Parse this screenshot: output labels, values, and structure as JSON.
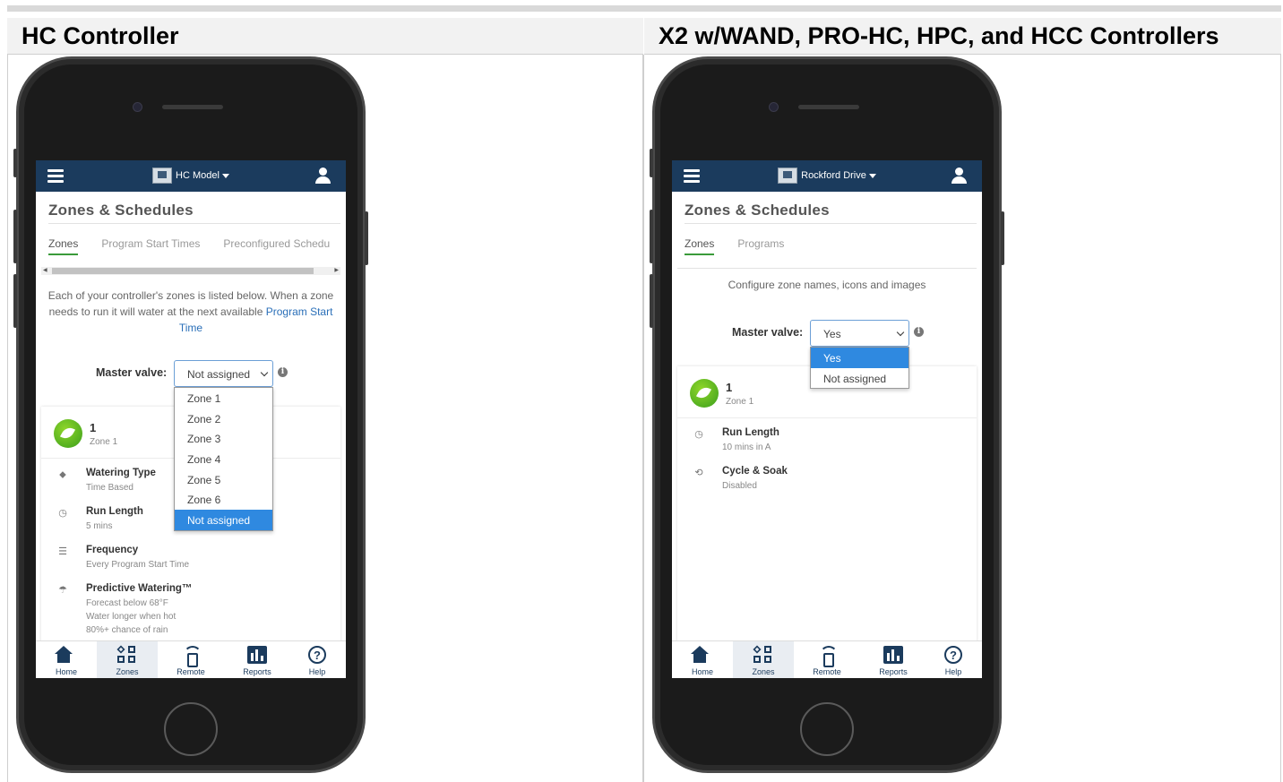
{
  "headers": {
    "left": "HC Controller",
    "right": "X2 w/WAND, PRO-HC, HPC, and HCC Controllers"
  },
  "left_phone": {
    "controller_name": "HC Model",
    "page_title": "Zones & Schedules",
    "tabs": [
      "Zones",
      "Program Start Times",
      "Preconfigured Schedu"
    ],
    "info_text": "Each of your controller's zones is listed below. When a zone needs to run it will water at the next available ",
    "info_link": "Program Start Time",
    "master_valve_label": "Master valve:",
    "master_valve_value": "Not assigned",
    "dropdown_options": [
      "Zone 1",
      "Zone 2",
      "Zone 3",
      "Zone 4",
      "Zone 5",
      "Zone 6",
      "Not assigned"
    ],
    "dropdown_selected_index": 6,
    "zone_number": "1",
    "zone_name": "Zone 1",
    "details": [
      {
        "icon": "tag-icon",
        "title": "Watering Type",
        "lines": [
          "Time Based"
        ]
      },
      {
        "icon": "clock-icon",
        "title": "Run Length",
        "lines": [
          "5 mins"
        ]
      },
      {
        "icon": "list-icon",
        "title": "Frequency",
        "lines": [
          "Every Program Start Time"
        ]
      },
      {
        "icon": "umbrella-icon",
        "title": "Predictive Watering™",
        "lines": [
          "Forecast below 68°F",
          "Water longer when hot",
          "80%+ chance of rain"
        ]
      }
    ]
  },
  "right_phone": {
    "controller_name": "Rockford Drive",
    "page_title": "Zones & Schedules",
    "tabs": [
      "Zones",
      "Programs"
    ],
    "info_text": "Configure zone names, icons and images",
    "master_valve_label": "Master valve:",
    "master_valve_value": "Yes",
    "dropdown_options": [
      "Yes",
      "Not assigned"
    ],
    "dropdown_selected_index": 0,
    "zone_number": "1",
    "zone_name": "Zone 1",
    "details": [
      {
        "icon": "clock-icon",
        "title": "Run Length",
        "lines": [
          "10 mins in A"
        ]
      },
      {
        "icon": "cycle-icon",
        "title": "Cycle & Soak",
        "lines": [
          "Disabled"
        ]
      }
    ]
  },
  "tabbar": [
    "Home",
    "Zones",
    "Remote",
    "Reports",
    "Help"
  ],
  "tabbar_active": "Zones",
  "colors": {
    "appbar": "#1b3b5d",
    "tab_underline": "#3a9a3a",
    "link": "#2a6fb8",
    "dropdown_selected": "#2f89e0",
    "leaf": "#3a9e1c"
  }
}
